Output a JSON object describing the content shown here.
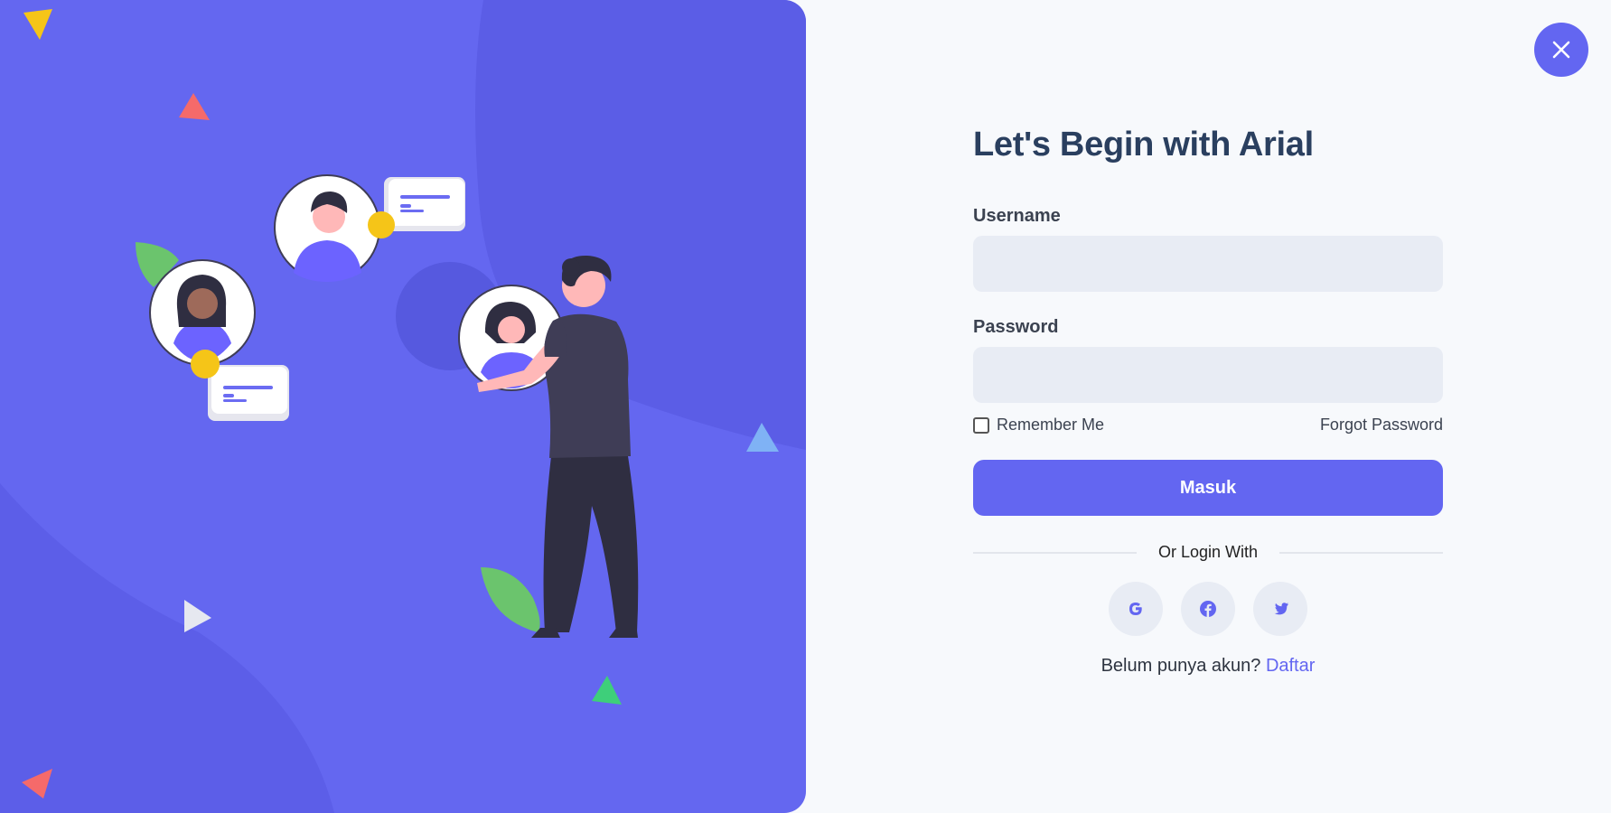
{
  "form": {
    "title": "Let's Begin with Arial",
    "username_label": "Username",
    "username_value": "",
    "password_label": "Password",
    "password_value": "",
    "remember_label": "Remember Me",
    "remember_checked": false,
    "forgot_label": "Forgot Password",
    "submit_label": "Masuk",
    "divider_text": "Or Login With",
    "register_prompt": "Belum punya akun?",
    "register_link": "Daftar"
  },
  "social": [
    "google-icon",
    "facebook-icon",
    "twitter-icon"
  ],
  "colors": {
    "accent": "#6366f1",
    "panel": "#6467f0",
    "heading": "#2a3f5f",
    "input_bg": "#e8ecf4",
    "page_bg": "#f7f9fc"
  }
}
